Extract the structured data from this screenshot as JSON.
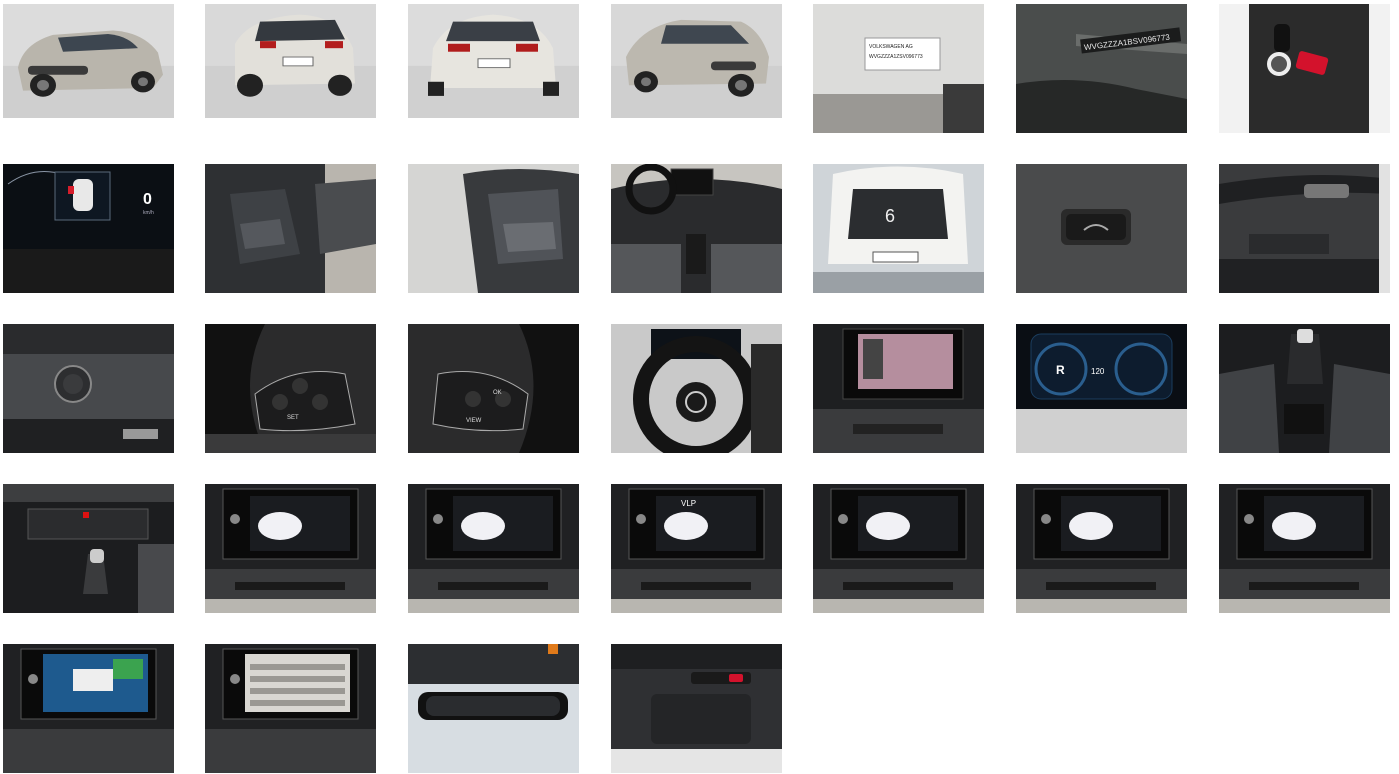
{
  "gallery": {
    "photos": [
      {
        "name": "exterior-front-left-photo",
        "scene": "car-front"
      },
      {
        "name": "exterior-rear-left-photo",
        "scene": "car-rear"
      },
      {
        "name": "exterior-rear-photo",
        "scene": "car-rear-straight"
      },
      {
        "name": "exterior-front-right-photo",
        "scene": "car-front-right"
      },
      {
        "name": "door-sticker-photo",
        "scene": "sticker",
        "text": [
          "VOLKSWAGEN AG",
          "WVGZZZA1ZSV096773"
        ]
      },
      {
        "name": "vin-plate-photo",
        "scene": "vin",
        "text": [
          "WVGZZZA1BSV096773"
        ]
      },
      {
        "name": "key-photo",
        "scene": "key"
      },
      {
        "name": "instrument-cluster-photo",
        "scene": "cluster",
        "text": [
          "0",
          "km/h"
        ]
      },
      {
        "name": "front-seats-photo",
        "scene": "seats-side"
      },
      {
        "name": "rear-seats-photo",
        "scene": "rear-seats"
      },
      {
        "name": "dashboard-overview-photo",
        "scene": "dash-overview"
      },
      {
        "name": "open-trunk-photo",
        "scene": "trunk"
      },
      {
        "name": "trunk-button-photo",
        "scene": "button"
      },
      {
        "name": "door-panel-photo",
        "scene": "door-panel"
      },
      {
        "name": "light-switch-photo",
        "scene": "light-switch"
      },
      {
        "name": "steering-wheel-left-buttons-photo",
        "scene": "wheel-left",
        "text": [
          "SET"
        ]
      },
      {
        "name": "steering-wheel-right-buttons-photo",
        "scene": "wheel-right",
        "text": [
          "OK",
          "VIEW"
        ]
      },
      {
        "name": "steering-wheel-photo",
        "scene": "wheel"
      },
      {
        "name": "rear-camera-screen-photo",
        "scene": "camera-screen"
      },
      {
        "name": "digital-cluster-photo",
        "scene": "digital-cluster",
        "text": [
          "R",
          "120"
        ]
      },
      {
        "name": "gear-shifter-photo",
        "scene": "shifter"
      },
      {
        "name": "climate-controls-photo",
        "scene": "climate"
      },
      {
        "name": "infotainment-home-photo",
        "scene": "infotainment"
      },
      {
        "name": "infotainment-settings-photo",
        "scene": "infotainment"
      },
      {
        "name": "infotainment-vehicle-photo",
        "scene": "infotainment",
        "text": [
          "VLP"
        ]
      },
      {
        "name": "infotainment-bluetooth-photo",
        "scene": "infotainment"
      },
      {
        "name": "infotainment-connect-photo",
        "scene": "infotainment"
      },
      {
        "name": "infotainment-app-connect-photo",
        "scene": "infotainment"
      },
      {
        "name": "infotainment-park-assist-photo",
        "scene": "park-assist"
      },
      {
        "name": "infotainment-menu-list-photo",
        "scene": "menu-list"
      },
      {
        "name": "rear-view-mirror-photo",
        "scene": "mirror"
      },
      {
        "name": "overhead-console-photo",
        "scene": "overhead"
      }
    ]
  }
}
